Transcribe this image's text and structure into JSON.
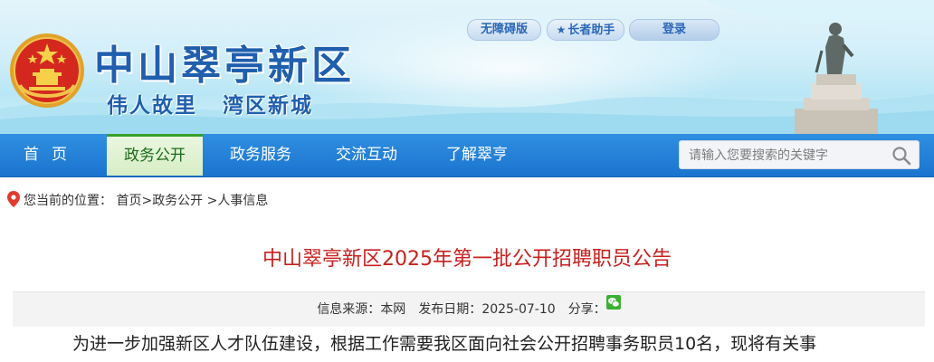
{
  "header": {
    "site_title": "中山翠亭新区",
    "slogan_left": "伟人故里",
    "slogan_right": "湾区新城",
    "accessibility_label": "无障碍版",
    "elder_mode_label": "长者助手",
    "login_label": "登录"
  },
  "nav": {
    "items": [
      {
        "label": "首页"
      },
      {
        "label": "政务公开"
      },
      {
        "label": "政务服务"
      },
      {
        "label": "交流互动"
      },
      {
        "label": "了解翠亨"
      }
    ],
    "active_index": 1,
    "search_placeholder": "请输入您要搜索的关键字"
  },
  "breadcrumb": {
    "prefix": "您当前的位置：",
    "items": [
      "首页",
      "政务公开",
      "人事信息"
    ],
    "separator": ">"
  },
  "article": {
    "title": "中山翠亭新区2025年第一批公开招聘职员公告",
    "source_label": "信息来源：",
    "source_value": "本网",
    "date_label": "发布日期：",
    "date_value": "2025-07-10",
    "share_label": "分享：",
    "body_first_line": "为进一步加强新区人才队伍建设，根据工作需要我区面向社会公开招聘事务职员10名，现将有关事"
  },
  "colors": {
    "brand_blue": "#1f5fae",
    "nav_blue": "#1b74cf",
    "active_tab_green": "#36a02a",
    "title_red": "#c8201d"
  },
  "icons": [
    "national-emblem-icon",
    "elder-assist-icon",
    "search-icon",
    "location-pin-icon",
    "wechat-icon"
  ]
}
